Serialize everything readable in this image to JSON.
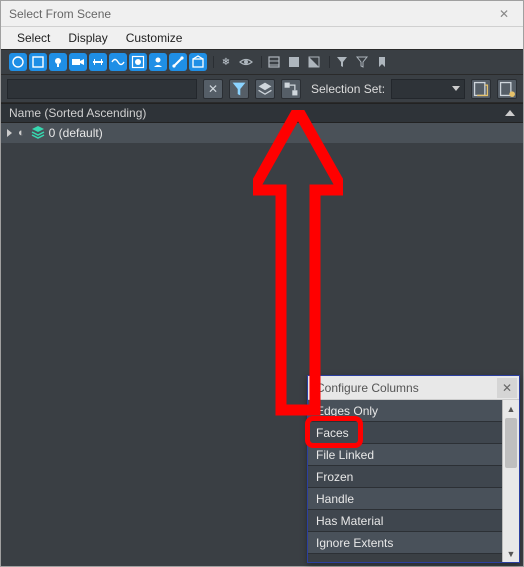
{
  "window": {
    "title": "Select From Scene"
  },
  "menu": {
    "select": "Select",
    "display": "Display",
    "customize": "Customize"
  },
  "row2": {
    "selection_set_label": "Selection Set:",
    "search_value": "",
    "search_placeholder": ""
  },
  "column_header": "Name (Sorted Ascending)",
  "tree": {
    "root_label": "0 (default)"
  },
  "popup": {
    "title": "Configure Columns",
    "items": [
      "Edges Only",
      "Faces",
      "File Linked",
      "Frozen",
      "Handle",
      "Has Material",
      "Ignore Extents"
    ]
  },
  "icons": {
    "close": "✕",
    "clear": "✕",
    "eye": "◉",
    "layers": "≣",
    "snow": "❄",
    "funnel": "▾",
    "tri_up": "▲",
    "tri_dn": "▼"
  }
}
